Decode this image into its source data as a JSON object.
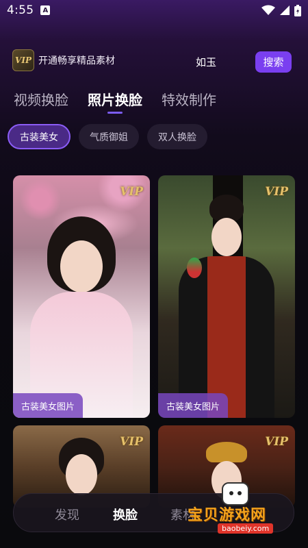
{
  "status_bar": {
    "time": "4:55",
    "notif_glyph": "A"
  },
  "header": {
    "vip_badge": "VIP",
    "vip_text": "开通畅享精品素材",
    "search_keyword": "如玉",
    "search_button": "搜索"
  },
  "main_tabs": [
    {
      "label": "视频换脸",
      "active": false
    },
    {
      "label": "照片换脸",
      "active": true
    },
    {
      "label": "特效制作",
      "active": false
    }
  ],
  "sub_tabs": [
    {
      "label": "古装美女",
      "active": true
    },
    {
      "label": "气质御姐",
      "active": false
    },
    {
      "label": "双人换脸",
      "active": false
    }
  ],
  "cards": [
    {
      "vip": "VIP",
      "caption": "古装美女图片"
    },
    {
      "vip": "VIP",
      "caption": "古装美女图片"
    },
    {
      "vip": "VIP"
    },
    {
      "vip": "VIP"
    }
  ],
  "bottom_nav": [
    {
      "label": "发现",
      "active": false
    },
    {
      "label": "换脸",
      "active": true
    },
    {
      "label": "素材",
      "active": false
    }
  ],
  "watermark": {
    "title": "宝贝游戏网",
    "url": "baobeiy.com"
  },
  "colors": {
    "accent": "#7a3ff0",
    "pill_active": "#4a2a86",
    "vip_gold": "#e5c06a"
  }
}
